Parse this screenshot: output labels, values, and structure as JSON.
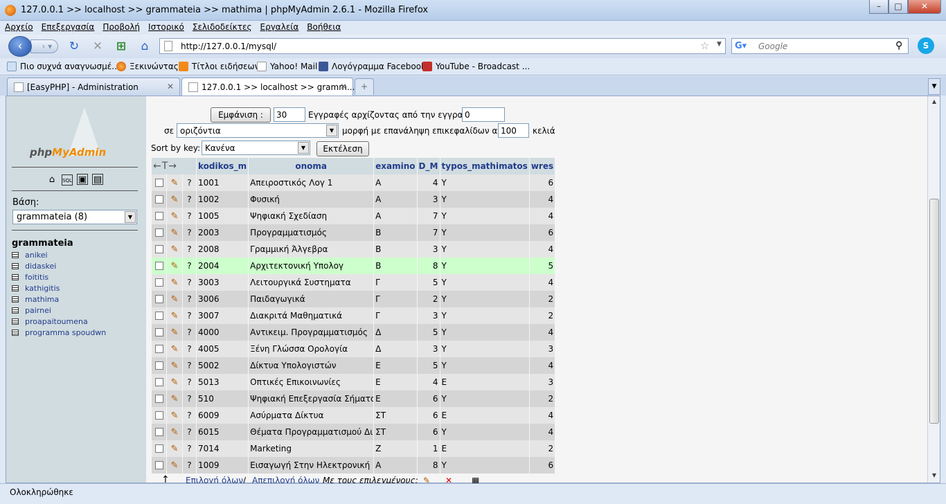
{
  "window": {
    "title": "127.0.0.1 >> localhost >> grammateia >> mathima | phpMyAdmin 2.6.1 - Mozilla Firefox"
  },
  "menu": [
    "Αρχείο",
    "Επεξεργασία",
    "Προβολή",
    "Ιστορικό",
    "Σελιδοδείκτες",
    "Εργαλεία",
    "Βοήθεια"
  ],
  "nav": {
    "url": "http://127.0.0.1/mysql/",
    "search_placeholder": "Google"
  },
  "bookmarks": [
    {
      "label": "Πιο συχνά αναγνωσμέ...",
      "icon": "page-icon"
    },
    {
      "label": "Ξεκινώντας",
      "icon": "firefox-icon"
    },
    {
      "label": "Τίτλοι ειδήσεων",
      "icon": "rss-icon"
    },
    {
      "label": "Yahoo! Mail",
      "icon": "page-icon"
    },
    {
      "label": "Λογόγραμμα Facebook",
      "icon": "facebook-icon"
    },
    {
      "label": "YouTube - Broadcast ...",
      "icon": "youtube-icon"
    }
  ],
  "tabs": [
    {
      "label": "[EasyPHP] - Administration",
      "active": false
    },
    {
      "label": "127.0.0.1 >> localhost >> gramm...",
      "active": true
    }
  ],
  "sidebar": {
    "logo_text_a": "php",
    "logo_text_b": "MyAdmin",
    "db_label": "Βάση:",
    "db_selected": "grammateia (8)",
    "db_name": "grammateia",
    "tables": [
      "anikei",
      "didaskei",
      "foititis",
      "kathigitis",
      "mathima",
      "pairnei",
      "proapaitoumena",
      "programma spoudwn"
    ]
  },
  "controls": {
    "show_button": "Εμφάνιση :",
    "rows_value": "30",
    "rows_text": "Εγγραφές αρχίζοντας από την εγγραφή",
    "start_value": "0",
    "in_label": "σε",
    "mode_value": "οριζόντια",
    "mode_text": "μορφή με επανάληψη επικεφαλίδων ανά",
    "repeat_value": "100",
    "cells_text": "κελιά",
    "sort_label": "Sort by key:",
    "sort_value": "Κανένα",
    "go_button": "Εκτέλεση"
  },
  "grid": {
    "arrows": "←T→",
    "columns": [
      "kodikos_m",
      "onoma",
      "examino",
      "D_M",
      "typos_mathimatos",
      "wres"
    ],
    "rows": [
      [
        "1001",
        "Απειροστικός Λογ 1",
        "A",
        "4",
        "Y",
        "6"
      ],
      [
        "1002",
        "Φυσική",
        "A",
        "3",
        "Y",
        "4"
      ],
      [
        "1005",
        "Ψηφιακή Σχεδίαση",
        "A",
        "7",
        "Y",
        "4"
      ],
      [
        "2003",
        "Προγραμματισμός",
        "B",
        "7",
        "Y",
        "6"
      ],
      [
        "2008",
        "Γραμμική Άλγεβρα",
        "B",
        "3",
        "Y",
        "4"
      ],
      [
        "2004",
        "Αρχιτεκτονική Υπολογ",
        "B",
        "8",
        "Y",
        "5"
      ],
      [
        "3003",
        "Λειτουργικά Συστηματα",
        "Γ",
        "5",
        "Y",
        "4"
      ],
      [
        "3006",
        "Παιδαγωγικά",
        "Γ",
        "2",
        "Y",
        "2"
      ],
      [
        "3007",
        "Διακριτά Μαθηματικά",
        "Γ",
        "3",
        "Y",
        "2"
      ],
      [
        "4000",
        "Αντικειμ. Προγραμματισμός",
        "Δ",
        "5",
        "Y",
        "4"
      ],
      [
        "4005",
        "Ξένη Γλώσσα Ορολογία",
        "Δ",
        "3",
        "Y",
        "3"
      ],
      [
        "5002",
        "Δίκτυα Υπολογιστών",
        "E",
        "5",
        "Y",
        "4"
      ],
      [
        "5013",
        "Οπτικές Επικοινωνίες",
        "E",
        "4",
        "E",
        "3"
      ],
      [
        "510",
        "Ψηφιακή Επεξεργασία Σήματος",
        "E",
        "6",
        "Y",
        "2"
      ],
      [
        "6009",
        "Ασύρματα Δίκτυα",
        "ΣΤ",
        "6",
        "E",
        "4"
      ],
      [
        "6015",
        "Θέματα Προγραμματισμού Διαδ",
        "ΣΤ",
        "6",
        "Y",
        "4"
      ],
      [
        "7014",
        "Marketing",
        "Z",
        "1",
        "E",
        "2"
      ],
      [
        "1009",
        "Εισαγωγή Στην Ηλεκτρονική",
        "A",
        "8",
        "Y",
        "6"
      ]
    ],
    "highlight_row": 5,
    "question": "?"
  },
  "bottom": {
    "arrow": "↑",
    "select_all": "Επιλογή όλων",
    "separator": "/",
    "deselect_all": "Απεπιλογή όλων",
    "with_selected": "Με τους επιλεγμένους:"
  },
  "status": {
    "text": "Ολοκληρώθηκε"
  }
}
